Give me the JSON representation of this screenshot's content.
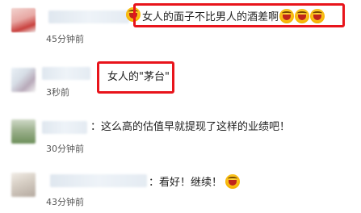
{
  "comments": [
    {
      "text": "女人的面子不比男人的酒差啊",
      "emoji_count": 3,
      "emoji": "grinning-laughing-emoji",
      "time": "45分钟前",
      "highlighted": true
    },
    {
      "text": "女人的\"茅台\"",
      "time": "3秒前",
      "highlighted": true
    },
    {
      "text": "：这么高的估值早就提现了这样的业绩吧！",
      "time": "30分钟前",
      "highlighted": false
    },
    {
      "text": "：看好！继续！",
      "emoji": "grinning-laughing-emoji",
      "time": "43分钟前",
      "highlighted": false
    }
  ],
  "colors": {
    "highlight": "#e8141b",
    "time": "#555555"
  }
}
